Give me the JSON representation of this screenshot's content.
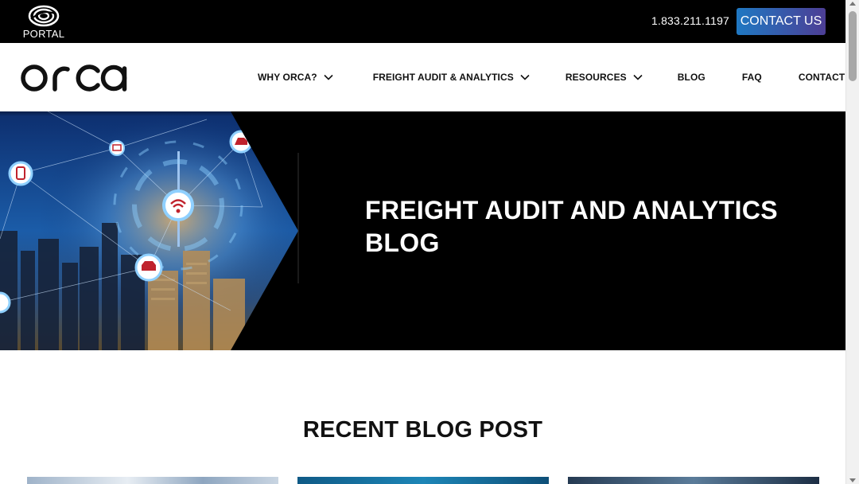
{
  "topbar": {
    "portal_label": "PORTAL",
    "portal_icon": "swirl-logo-icon",
    "phone": "1.833.211.1197",
    "cta_label": "CONTACT US"
  },
  "logo": {
    "text": "orca"
  },
  "nav": {
    "items": [
      {
        "label": "WHY ORCA?",
        "has_dropdown": true
      },
      {
        "label": "FREIGHT AUDIT & ANALYTICS",
        "has_dropdown": true
      },
      {
        "label": "RESOURCES",
        "has_dropdown": true
      },
      {
        "label": "BLOG",
        "has_dropdown": false
      },
      {
        "label": "FAQ",
        "has_dropdown": false
      },
      {
        "label": "CONTACT US",
        "has_dropdown": false
      }
    ]
  },
  "hero": {
    "title_line1": "FREIGHT AUDIT AND ANALYTICS",
    "title_line2": "BLOG"
  },
  "recent": {
    "title": "RECENT BLOG POST"
  },
  "colors": {
    "cta_start": "#1f78c2",
    "cta_end": "#4d3e95",
    "topbar": "#000000",
    "hero_bg": "#000000"
  }
}
